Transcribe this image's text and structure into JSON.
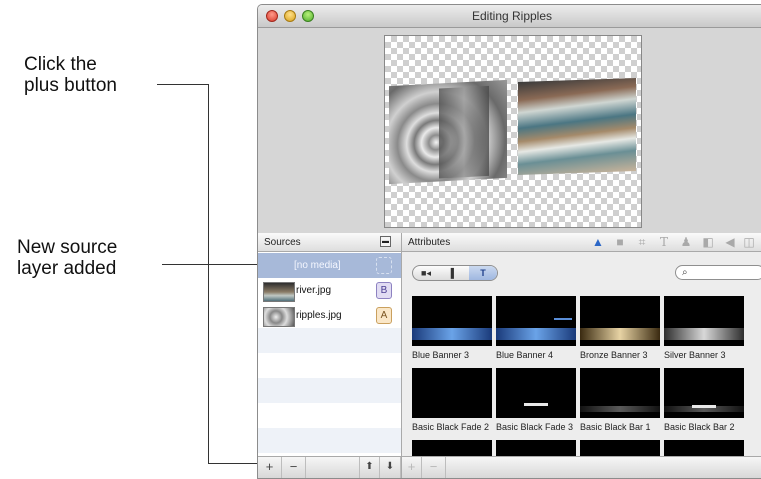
{
  "callouts": {
    "plus": [
      "Click the",
      "plus button"
    ],
    "layer": [
      "New source",
      "layer added"
    ]
  },
  "window": {
    "title": "Editing Ripples"
  },
  "sources": {
    "header": "Sources",
    "header_button_icon": "layer-options-icon",
    "items": [
      {
        "label": "[no media]",
        "badge": "",
        "selected": true
      },
      {
        "label": "river.jpg",
        "badge": "B",
        "badge_color": "#e1dcf3"
      },
      {
        "label": "ripples.jpg",
        "badge": "A",
        "badge_color": "#fae7c8"
      }
    ],
    "toolbar": {
      "add": "+",
      "remove": "−",
      "move_up": "⬆",
      "move_down": "⬇"
    }
  },
  "attributes": {
    "header": "Attributes",
    "icons": [
      "objects-icon",
      "speech-icon",
      "crop-icon",
      "text-icon",
      "person-icon",
      "split-icon",
      "audio-icon",
      "more-icon"
    ],
    "segment": [
      {
        "icon": "video-icon",
        "glyph": "■◂"
      },
      {
        "icon": "document-icon",
        "glyph": "▌"
      },
      {
        "icon": "text-icon",
        "glyph": "T",
        "selected": true
      }
    ],
    "search_placeholder": "",
    "toolbar": {
      "add": "+",
      "remove": "−"
    },
    "tiles": [
      {
        "label": "Blue Banner 3",
        "style": "blue"
      },
      {
        "label": "Blue Banner 4",
        "style": "blue"
      },
      {
        "label": "Bronze Banner 3",
        "style": "bronze"
      },
      {
        "label": "Silver Banner 3",
        "style": "silver"
      },
      {
        "label": "Basic Black Fade 2",
        "style": "black"
      },
      {
        "label": "Basic Black Fade 3",
        "style": "thin"
      },
      {
        "label": "Basic Black Bar 1",
        "style": "grey"
      },
      {
        "label": "Basic Black Bar 2",
        "style": "grey-thin"
      }
    ]
  },
  "colors": {
    "selection": "#a7b9d9",
    "callout_line": "#333333"
  }
}
